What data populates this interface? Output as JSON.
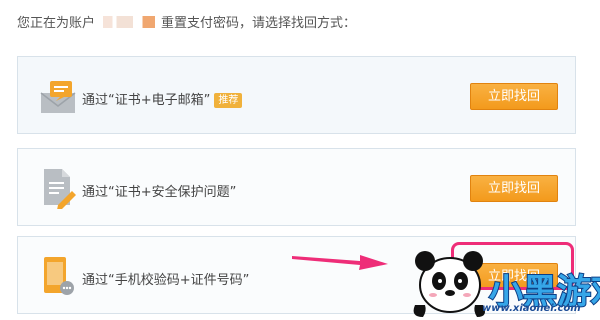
{
  "intro": {
    "prefix": "您正在为账户",
    "suffix": "重置支付密码，请选择找回方式："
  },
  "options": [
    {
      "label": "通过“证书+电子邮箱”",
      "badge": "推荐",
      "button": "立即找回",
      "icon": "email-envelope-icon"
    },
    {
      "label": "通过“证书+安全保护问题”",
      "button": "立即找回",
      "icon": "document-pencil-icon"
    },
    {
      "label": "通过“手机校验码+证件号码”",
      "button": "立即找回",
      "icon": "mobile-phone-icon"
    }
  ],
  "watermark": {
    "brand": "小黑游戏",
    "url": "www.xiaohei.com"
  },
  "colors": {
    "accent": "#f39a1c",
    "highlight": "#ee2d78",
    "watermark_blue": "#1d4d97"
  }
}
